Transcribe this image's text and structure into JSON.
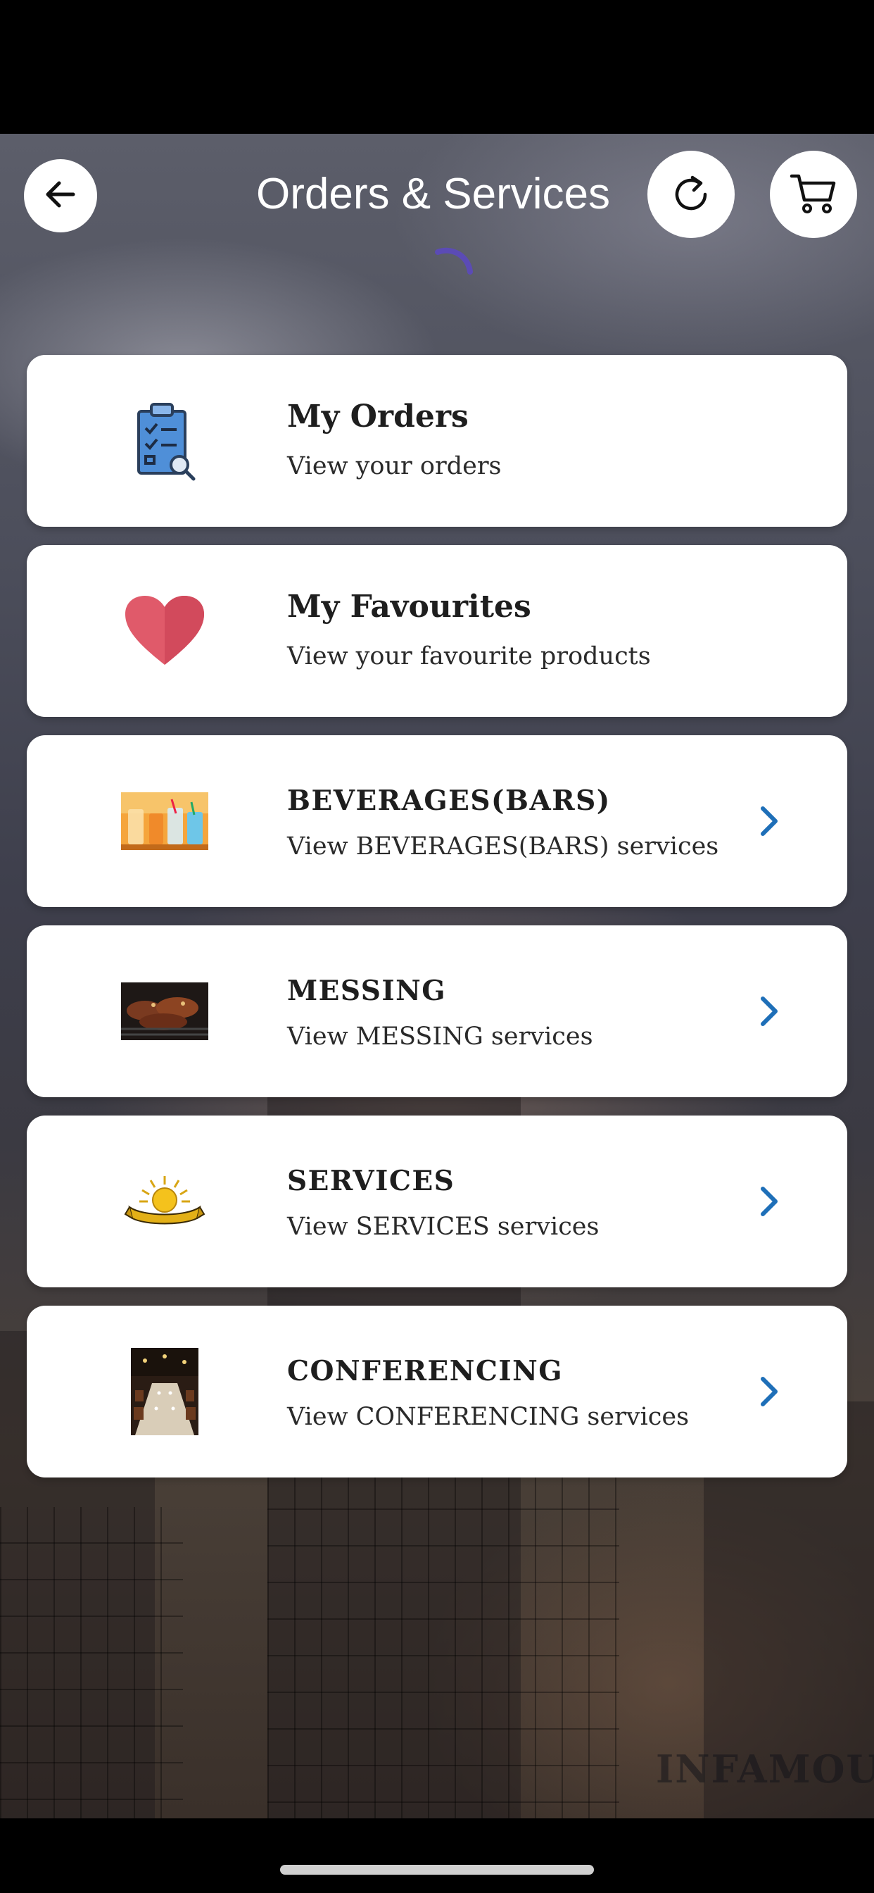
{
  "header": {
    "title": "Orders & Services"
  },
  "icons": {
    "back": "arrow-left-icon",
    "refresh": "refresh-icon",
    "cart": "shopping-cart-icon",
    "loading": "loading-spinner-icon",
    "chevron": "chevron-right-icon"
  },
  "colors": {
    "accent_spinner": "#5b4bb5",
    "chevron": "#1e6fb8",
    "heart": "#e05a6a",
    "card_background": "#ffffff"
  },
  "menu": [
    {
      "title": "My Orders",
      "subtitle": "View your orders",
      "icon": "clipboard-checklist-icon",
      "has_chevron": false
    },
    {
      "title": "My Favourites",
      "subtitle": "View your favourite products",
      "icon": "heart-icon",
      "has_chevron": false
    },
    {
      "title": "BEVERAGES(BARS)",
      "subtitle": "View BEVERAGES(BARS) services",
      "icon": "beverages-photo",
      "has_chevron": true
    },
    {
      "title": "MESSING",
      "subtitle": "View MESSING services",
      "icon": "grilled-food-photo",
      "has_chevron": true
    },
    {
      "title": "SERVICES",
      "subtitle": "View SERVICES services",
      "icon": "sun-emblem-icon",
      "has_chevron": true
    },
    {
      "title": "CONFERENCING",
      "subtitle": "View CONFERENCING services",
      "icon": "conference-room-photo",
      "has_chevron": true
    }
  ],
  "background": {
    "watermark_text": "INFAMOUS"
  }
}
